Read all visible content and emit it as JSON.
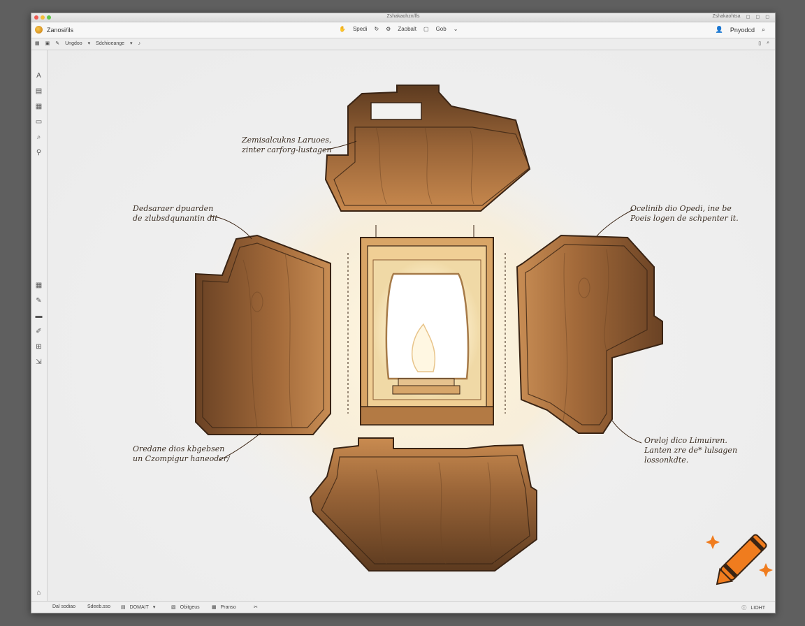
{
  "window": {
    "title": "Zshakaohzn/lfs",
    "app_name": "Zanosi/ils",
    "title_right": [
      "Zshakaohtsa",
      "◻",
      "◻",
      "◻"
    ]
  },
  "toolbar": {
    "items": [
      "Spedi",
      "Zaobalt",
      "Gob"
    ],
    "right_label": "Pnyodcd"
  },
  "subbar": {
    "items": [
      "Ungdoo",
      "Sdchioeange"
    ]
  },
  "annotations": {
    "top": [
      "Zemisalcukns Laruoes,",
      "zinter carforg-lustagen"
    ],
    "left_upper": [
      "Dedsaraer dpuarden",
      "de zlubsdqunantin dit"
    ],
    "right_upper": [
      "Ocelinib dio Opedi, ine be",
      "Poeis logen de schpenter it."
    ],
    "left_lower": [
      "Oredane dios kbgebsen",
      "un Czompigur haneoder/"
    ],
    "right_lower": [
      "Oreloj dico Limuiren.",
      "Lanten zre de* lulsagen",
      "lossonkdte."
    ]
  },
  "statusbar": {
    "items": [
      "Dal sodiao",
      "Sdeeb.sso",
      "DOMAIT",
      "Obitgeus",
      "Pranso",
      "LIOHT"
    ]
  },
  "colors": {
    "wood": "#8a5a32",
    "wood_light": "#c48a52",
    "outline": "#3a2414",
    "glow": "#fff6dc",
    "crayon": "#f07c1e"
  },
  "icons": [
    "select-arrow-icon",
    "brush-icon",
    "layers-icon",
    "rectangle-icon",
    "zoom-icon",
    "search-icon",
    "grid-icon",
    "pencil-icon",
    "crop-icon",
    "settings-icon",
    "user-icon",
    "crayon-logo-icon"
  ]
}
